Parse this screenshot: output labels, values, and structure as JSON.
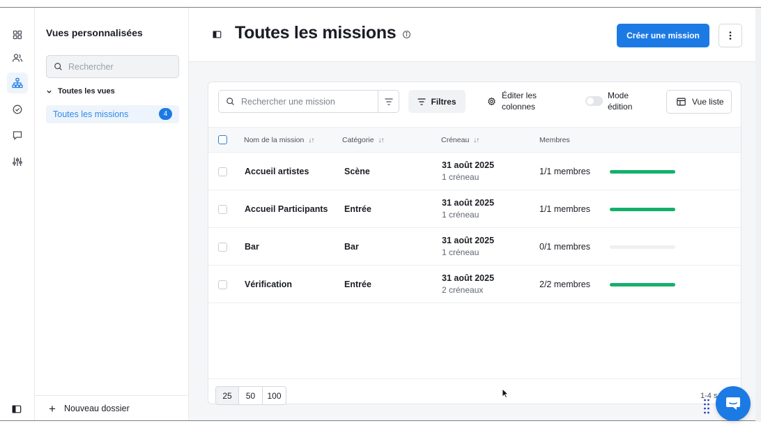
{
  "sidebar": {
    "title": "Vues personnalisées",
    "search_placeholder": "Rechercher",
    "group_label": "Toutes les vues",
    "active_view": {
      "label": "Toutes les missions",
      "badge": "4"
    },
    "footer_label": "Nouveau dossier"
  },
  "header": {
    "title": "Toutes les missions",
    "primary_button": "Créer une mission"
  },
  "toolbar": {
    "search_placeholder": "Rechercher une mission",
    "filters_label": "Filtres",
    "edit_columns_label": "Éditer les colonnes",
    "edit_mode_label": "Mode édition",
    "list_view_label": "Vue liste"
  },
  "table": {
    "columns": [
      "Nom de la mission",
      "Catégorie",
      "Créneau",
      "Membres"
    ],
    "rows": [
      {
        "name": "Accueil artistes",
        "category": "Scène",
        "date": "31 août 2025",
        "slots": "1 créneau",
        "members": "1/1 membres",
        "fill": 1.0
      },
      {
        "name": "Accueil Participants",
        "category": "Entrée",
        "date": "31 août 2025",
        "slots": "1 créneau",
        "members": "1/1 membres",
        "fill": 1.0
      },
      {
        "name": "Bar",
        "category": "Bar",
        "date": "31 août 2025",
        "slots": "1 créneau",
        "members": "0/1 membres",
        "fill": 0.0
      },
      {
        "name": "Vérification",
        "category": "Entrée",
        "date": "31 août 2025",
        "slots": "2 créneaux",
        "members": "2/2 membres",
        "fill": 1.0
      }
    ]
  },
  "pagination": {
    "sizes": [
      "25",
      "50",
      "100"
    ],
    "count_text": "1-4 s"
  },
  "colors": {
    "accent": "#1c7ae5",
    "progress": "#14b06a"
  },
  "icons": {
    "rail": [
      "dashboard-icon",
      "users-icon",
      "org-chart-icon",
      "check-circle-icon",
      "chat-icon",
      "sliders-icon"
    ]
  }
}
